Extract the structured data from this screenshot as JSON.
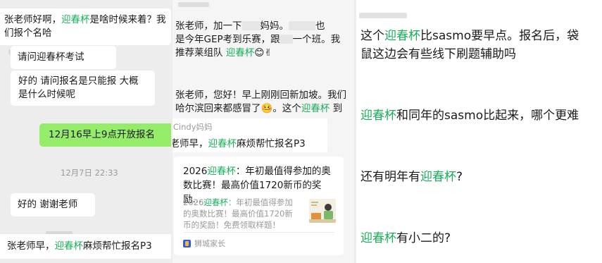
{
  "col1": {
    "top_bubble": {
      "p1": "张老师好啊，",
      "hl": "迎春杯",
      "p2": "是啥时候来着？我们报个名哈"
    },
    "q1": "请问迎春杯考试",
    "q2": "好的 请问报名是只能报 大概是什么时候呢",
    "reply_green": "12月16早上9点开放报名",
    "timestamp": "12月7日 22:33",
    "thanks": "好的 谢谢老师",
    "bottom": {
      "p1": "张老师早，",
      "hl": "迎春杯",
      "p2": "麻烦帮忙报名P3"
    }
  },
  "col2": {
    "msg1": {
      "a": "张老师，加一下",
      "b": "妈妈。",
      "c": "也",
      "d": "是今年GEP考到乐赛，跟",
      "e": "一个班。我",
      "f": "推荐莱组队 ",
      "hl": "迎春杯",
      "emoji": "😊✌"
    },
    "msg2": {
      "p1": "张老师，您好！早上刚刚回新加坡。我们哈尔滨回来都感冒了",
      "emoji": "🤒",
      "p2": "。这个",
      "hl": "迎春杯",
      "p3": " 到"
    },
    "quote": {
      "sender": "P3 Cindy妈妈",
      "p1": "张老师早，",
      "hl": "迎春杯",
      "p2": "麻烦帮忙报名P3"
    },
    "card": {
      "title_p1": "2026",
      "title_hl": "迎春杯",
      "title_p2": "：年初最值得参加的奥数比赛！最高价值1720新币的奖励...",
      "desc_p1": "2026",
      "desc_hl": "迎春杯",
      "desc_p2": "：年初最值得参加的奥数比赛！最高价值1720新币的奖励！免费领取样题！",
      "source": "狮城家长"
    }
  },
  "col3": {
    "l1": {
      "p1": "这个",
      "hl": "迎春杯",
      "p2": "比sasmo要早点。报名后，袋"
    },
    "l1b": "鼠这边会有些线下刷题辅助吗",
    "l2": {
      "hl": "迎春杯",
      "p2": "和同年的sasmo比起来，哪个更难"
    },
    "l3": {
      "p1": "还有明年有",
      "hl": "迎春杯",
      "p2": "?"
    },
    "l4": {
      "hl": "迎春杯",
      "p2": "有小二的?"
    }
  },
  "colors": {
    "highlight": "#1aad5a",
    "green_bubble": "#95ec69",
    "chat_bg": "#ededed"
  }
}
